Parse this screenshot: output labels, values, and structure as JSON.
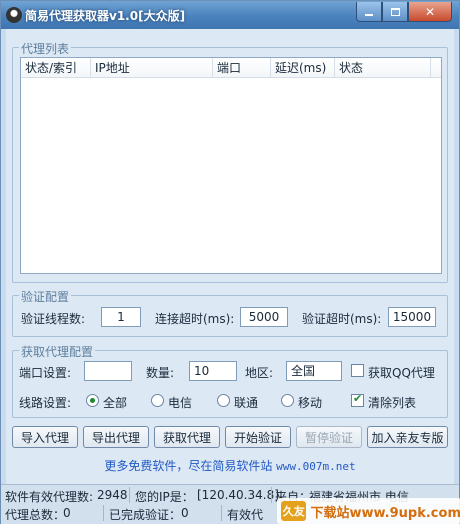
{
  "window": {
    "title": "简易代理获取器v1.0[大众版]"
  },
  "title_buttons": {
    "close": "✕"
  },
  "proxy_list": {
    "group_title": "代理列表",
    "columns": [
      "状态/索引",
      "IP地址",
      "端口",
      "延迟(ms)",
      "状态"
    ]
  },
  "verify_config": {
    "group_title": "验证配置",
    "threads_label": "验证线程数:",
    "threads_value": "1",
    "connect_timeout_label": "连接超时(ms):",
    "connect_timeout_value": "5000",
    "verify_timeout_label": "验证超时(ms):",
    "verify_timeout_value": "15000"
  },
  "fetch_config": {
    "group_title": "获取代理配置",
    "port_label": "端口设置:",
    "port_value": "",
    "count_label": "数量:",
    "count_value": "10",
    "region_label": "地区:",
    "region_value": "全国",
    "qq_proxy_label": "获取QQ代理",
    "qq_proxy_checked": false,
    "line_label": "线路设置:",
    "line_options": [
      "全部",
      "电信",
      "联通",
      "移动"
    ],
    "line_selected": "全部",
    "clear_list_label": "清除列表",
    "clear_list_checked": true
  },
  "buttons": {
    "import": "导入代理",
    "export": "导出代理",
    "fetch": "获取代理",
    "start_verify": "开始验证",
    "pause_verify": "暂停验证",
    "join_qq": "加入亲友专版"
  },
  "promo": {
    "text": "更多免费软件，尽在简易软件站",
    "site": "www.007m.net"
  },
  "status": {
    "valid_count_label": "软件有效代理数:",
    "valid_count_value": "2948",
    "ip_label": "您的IP是：",
    "ip_value": "[120.40.34.8]",
    "from_label": "来自：",
    "from_value": "福建省福州市 电信",
    "total_label": "代理总数：",
    "total_value": "0",
    "done_label": "已完成验证：",
    "done_value": "0",
    "valid_label": "有效代"
  },
  "watermark": {
    "badge": "久友",
    "text": "下载站www.9upk.com"
  },
  "colors": {
    "title_bar": "#4a82bd",
    "client_bg": "#dde8f5",
    "promo_link": "#2159c5"
  }
}
